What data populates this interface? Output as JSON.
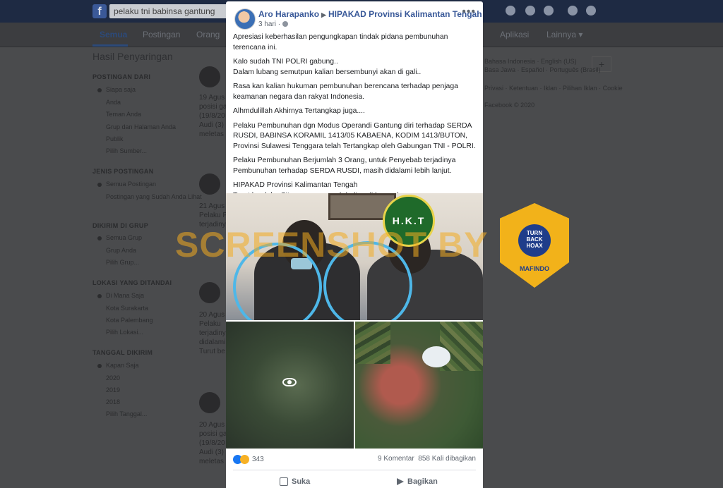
{
  "topbar": {
    "search_value": "pelaku tni babinsa gantung",
    "logo": "f"
  },
  "tabs": [
    "Semua",
    "Postingan",
    "Orang",
    "Aplikasi",
    "Lainnya ▾"
  ],
  "sidebar": {
    "title": "Hasil Penyaringan",
    "sections": [
      {
        "heading": "POSTINGAN DARI",
        "items": [
          "Siapa saja",
          "Anda",
          "Teman Anda",
          "Grup dan Halaman Anda",
          "Publik",
          "Pilih Sumber..."
        ]
      },
      {
        "heading": "JENIS POSTINGAN",
        "items": [
          "Semua Postingan",
          "Postingan yang Sudah Anda Lihat"
        ]
      },
      {
        "heading": "DIKIRIM DI GRUP",
        "items": [
          "Semua Grup",
          "Grup Anda",
          "Pilih Grup..."
        ]
      },
      {
        "heading": "LOKASI YANG DITANDAI",
        "items": [
          "Di Mana Saja",
          "Kota Surakarta",
          "Kota Palembang",
          "Pilih Lokasi..."
        ]
      },
      {
        "heading": "TANGGAL DIKIRIM",
        "items": [
          "Kapan Saja",
          "2020",
          "2019",
          "2018",
          "Pilih Tanggal..."
        ]
      }
    ]
  },
  "feed_snippets": [
    [
      "19 Agus",
      "posisi ga",
      "(19/8/20",
      "Audi (3)",
      "meletas"
    ],
    [
      "21 Agus",
      "Pelaku P",
      "terjadiny"
    ],
    [
      "20 Agus",
      "Pelaku",
      "terjadiny",
      "didalami",
      "Turut be"
    ],
    [
      "20 Agus",
      "posisi ga",
      "(19/8/20",
      "Audi (3)",
      "meletas"
    ]
  ],
  "right_column": [
    "Bahasa Indonesia · English (US)",
    "Basa Jawa · Español · Português (Brasil)",
    "Privasi · Ketentuan · Iklan · Pilihan Iklan · Cookie",
    "Facebook © 2020"
  ],
  "post": {
    "author": "Aro Harapanko",
    "group": "HIPAKAD Provinsi Kalimantan Tengah",
    "time": "3 hari ·",
    "paragraphs": [
      "Apresiasi keberhasilan pengungkapan tindak pidana pembunuhan terencana ini.",
      "Kalo sudah TNI POLRI gabung..\nDalam lubang semutpun kalian bersembunyi akan di gali..",
      "Rasa kan kalian hukuman pembunuhan berencana terhadap penjaga keamanan negara dan rakyat Indonesia.",
      "Alhmdulillah Akhirnya Tertangkap juga....",
      "Pelaku Pembunuhan dgn Modus Operandi Gantung diri terhadap SERDA RUSDI, BABINSA KORAMIL 1413/05 KABAENA, KODIM 1413/BUTON, Provinsi Sulawesi Tenggara telah Tertangkap oleh Gabungan TNI - POLRI.",
      "Pelaku Pembunuhan Berjumlah 3 Orang, untuk Penyebab terjadinya Pembunuhan terhadap SERDA RUSDI, masih didalami lebih lanjut.",
      "HIPAKAD Provinsi Kalimantan Tengah\nTurut berduka Cita semoga arwah beliau di lapangkan."
    ],
    "image_logo_text": "H.K.T",
    "reaction_count": "343",
    "comments": "9 Komentar",
    "shares": "858 Kali dibagikan",
    "like_label": "Suka",
    "share_label": "Bagikan"
  },
  "watermark": "SCREENSHOT BY",
  "badge": {
    "top": "TURN BACK HOAX",
    "bottom": "MAFINDO"
  }
}
